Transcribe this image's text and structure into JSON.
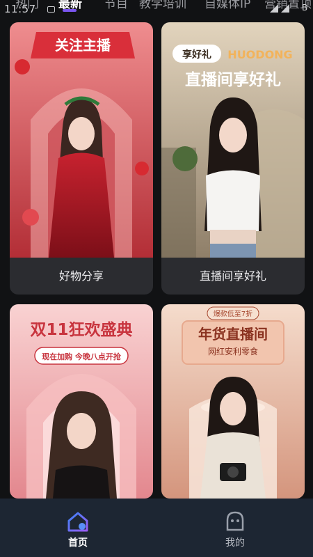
{
  "status_bar": {
    "time": "11:57",
    "right_glyph": "B"
  },
  "tabs": [
    {
      "label": "热门",
      "active": false
    },
    {
      "label": "最新",
      "active": true
    },
    {
      "label": "节目",
      "active": false
    },
    {
      "label": "教学培训",
      "active": false
    },
    {
      "label": "自媒体IP",
      "active": false
    },
    {
      "label": "营销置顶",
      "active": false
    }
  ],
  "cards": [
    {
      "caption": "好物分享",
      "banner_text": "关注主播",
      "theme": {
        "bg_top": "#e8747a",
        "bg_bottom": "#b8323a",
        "accent": "#d92f3a"
      }
    },
    {
      "caption": "直播间享好礼",
      "badge_text": "享好礼",
      "brand_text": "HUODONG",
      "headline": "直播间享好礼",
      "theme": {
        "bg_top": "#d9cbb5",
        "bg_bottom": "#9a8a73",
        "accent": "#f2b35b"
      }
    },
    {
      "caption": "",
      "headline": "双11狂欢盛典",
      "sub_pill": "现在加购 今晚八点开抢",
      "theme": {
        "bg_top": "#f7c4c6",
        "bg_bottom": "#e2838a",
        "accent": "#c8343e"
      }
    },
    {
      "caption": "",
      "top_tag": "爆款低至7折",
      "headline": "年货直播间",
      "sub_headline": "网红安利零食",
      "theme": {
        "bg_top": "#f3d4c3",
        "bg_bottom": "#d99a82",
        "accent": "#a7472e"
      }
    }
  ],
  "bottom_nav": [
    {
      "label": "首页",
      "icon": "home-icon",
      "active": true
    },
    {
      "label": "我的",
      "icon": "profile-icon",
      "active": false
    }
  ],
  "colors": {
    "background": "#111214",
    "card": "#2b2c30",
    "nav_bg": "#1d2633",
    "active_accent": "#7a55f0"
  }
}
